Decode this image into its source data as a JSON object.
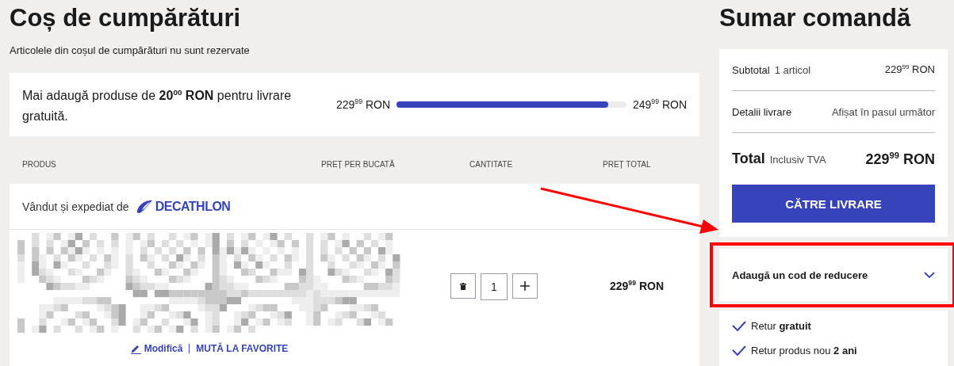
{
  "cart": {
    "title": "Coș de cumpărături",
    "subtitle": "Articolele din coșul de cumpărături nu sunt rezervate",
    "shipping": {
      "message": "Mai adaugă produse de **20$^{00}$ RON** pentru livrare gratuită.",
      "current": "229$^{99}$ RON",
      "target": "249$^{99}$ RON",
      "level": 0.92
    },
    "columns": [
      "PRODUS",
      "PREȚ PER BUCATĂ",
      "CANTITATE",
      "PREȚ TOTAL"
    ],
    "seller": {
      "label": "Vândut și expediat de",
      "logo": "DECATHLON"
    },
    "items": [
      {
        "kind": "picture",
        "quantity": "1",
        "total": "229$^{99}$ RON",
        "actions": [
          "Modifică",
          "MUTĂ LA FAVORITE"
        ]
      }
    ]
  },
  "summary": {
    "title": "Sumar comandă",
    "rows": [
      {
        "label": "Subtotal",
        "note": "1 articol",
        "value": "229$^{99}$ RON"
      },
      {
        "label": "Detalii livrare",
        "value": "Afișat în pasul următor"
      }
    ],
    "total": {
      "label": "Total",
      "note": "Inclusiv TVA",
      "value": "229$^{99}$ RON"
    },
    "button": "CĂTRE LIVRARE",
    "discount": {
      "label": "Adaugă un cod de reducere",
      "expanded": false,
      "highlighted": true
    },
    "benefits": [
      "Retur **gratuit**",
      "Retur produs nou **2 ani**"
    ]
  }
}
